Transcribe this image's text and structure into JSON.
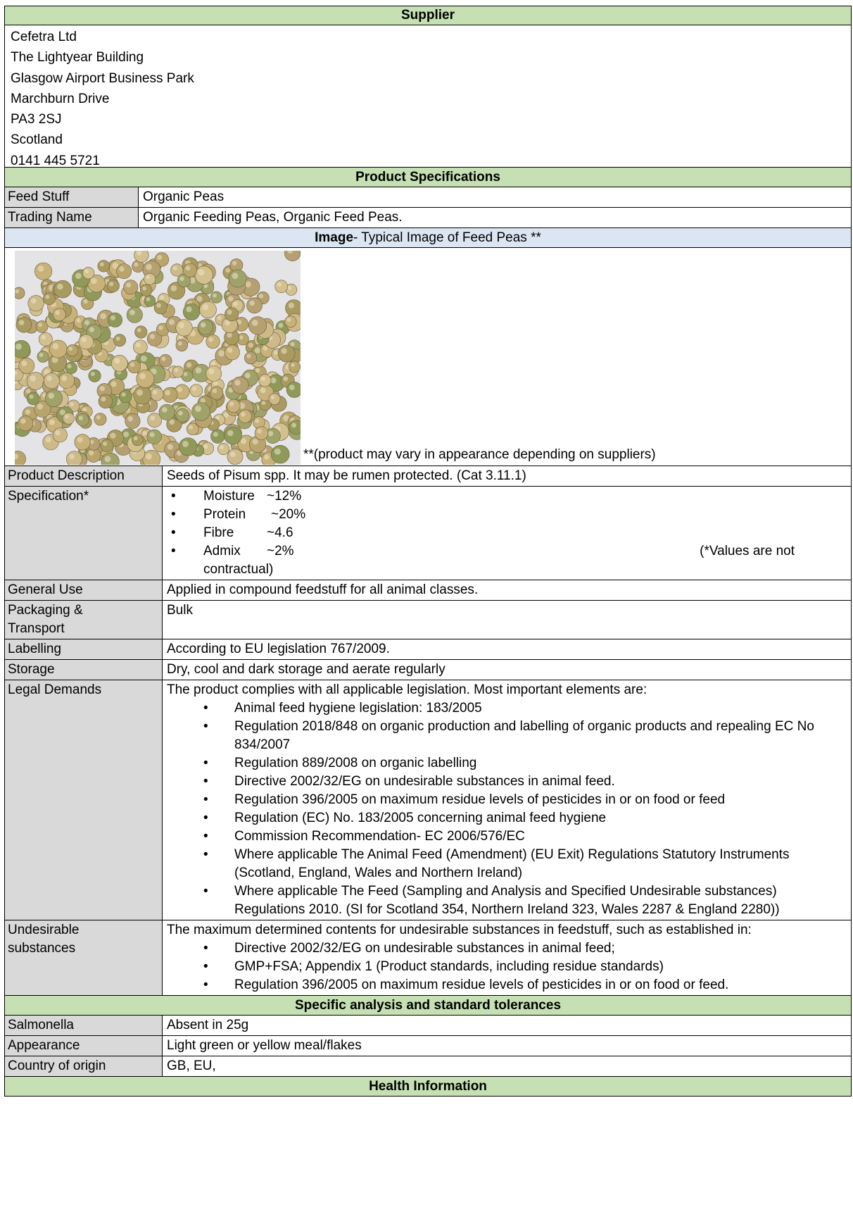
{
  "supplier": {
    "header": "Supplier",
    "lines": [
      "Cefetra Ltd",
      "The Lightyear Building",
      "Glasgow Airport Business Park",
      "Marchburn Drive",
      "PA3 2SJ",
      "Scotland",
      "0141 445 5721"
    ]
  },
  "product_specs": {
    "header": "Product Specifications",
    "feed_stuff_label": "Feed Stuff",
    "feed_stuff_value": "Organic Peas",
    "trading_name_label": "Trading Name",
    "trading_name_value": "Organic Feeding Peas, Organic Feed Peas."
  },
  "image_section": {
    "header_bold": "Image",
    "header_rest": "- Typical Image of Feed Peas **",
    "caption": "**(product may vary in appearance depending on suppliers)"
  },
  "details": {
    "product_description_label": "Product Description",
    "product_description_value": "Seeds of Pisum spp. It may be rumen protected. (Cat 3.11.1)",
    "specification_label": "Specification*",
    "specification_items": [
      {
        "name": "Moisture",
        "value": "~12%"
      },
      {
        "name": "Protein",
        "value": "~20%"
      },
      {
        "name": "Fibre",
        "value": "~4.6"
      },
      {
        "name": "Admix",
        "value": "~2%"
      }
    ],
    "specification_note_a": "(*Values are not",
    "specification_note_b": "contractual)",
    "general_use_label": "General Use",
    "general_use_value": "Applied in compound feedstuff for all animal classes.",
    "packaging_label_a": "Packaging &",
    "packaging_label_b": "Transport",
    "packaging_value": "Bulk",
    "labelling_label": "Labelling",
    "labelling_value": "According to EU legislation 767/2009.",
    "storage_label": "Storage",
    "storage_value": "Dry, cool and dark storage and aerate regularly",
    "legal_label": "Legal Demands",
    "legal_intro": "The product complies with all applicable legislation. Most important elements are:",
    "legal_items": [
      "Animal feed hygiene legislation: 183/2005",
      "Regulation 2018/848 on organic production and labelling of organic products and repealing EC No 834/2007",
      "Regulation 889/2008 on organic labelling",
      "Directive 2002/32/EG on undesirable substances in animal feed.",
      "Regulation 396/2005 on maximum residue levels of pesticides in or on food or feed",
      "Regulation (EC) No. 183/2005 concerning animal feed hygiene",
      "Commission Recommendation- EC 2006/576/EC",
      "Where applicable The Animal Feed (Amendment) (EU Exit) Regulations Statutory Instruments (Scotland, England, Wales and Northern Ireland)",
      "Where applicable The Feed (Sampling and Analysis and Specified Undesirable substances) Regulations 2010. (SI for Scotland 354, Northern Ireland 323, Wales 2287 & England 2280))"
    ],
    "undesirable_label_a": "Undesirable",
    "undesirable_label_b": "substances",
    "undesirable_intro": "The maximum determined contents for undesirable substances in feedstuff, such as established in:",
    "undesirable_items": [
      "Directive 2002/32/EG on undesirable substances in animal feed;",
      "GMP+FSA; Appendix 1 (Product standards, including residue standards)",
      "Regulation 396/2005 on maximum residue levels of pesticides in or on food or feed."
    ]
  },
  "analysis": {
    "header": "Specific analysis and standard tolerances",
    "salmonella_label": "Salmonella",
    "salmonella_value": "Absent in 25g",
    "appearance_label": "Appearance",
    "appearance_value": "Light green or yellow meal/flakes",
    "origin_label": "Country of origin",
    "origin_value": "GB, EU,"
  },
  "health": {
    "header": "Health Information"
  },
  "colors": {
    "section_header": "#c6e0b4",
    "image_header": "#dce6f2",
    "label_cell": "#d9d9d9"
  }
}
